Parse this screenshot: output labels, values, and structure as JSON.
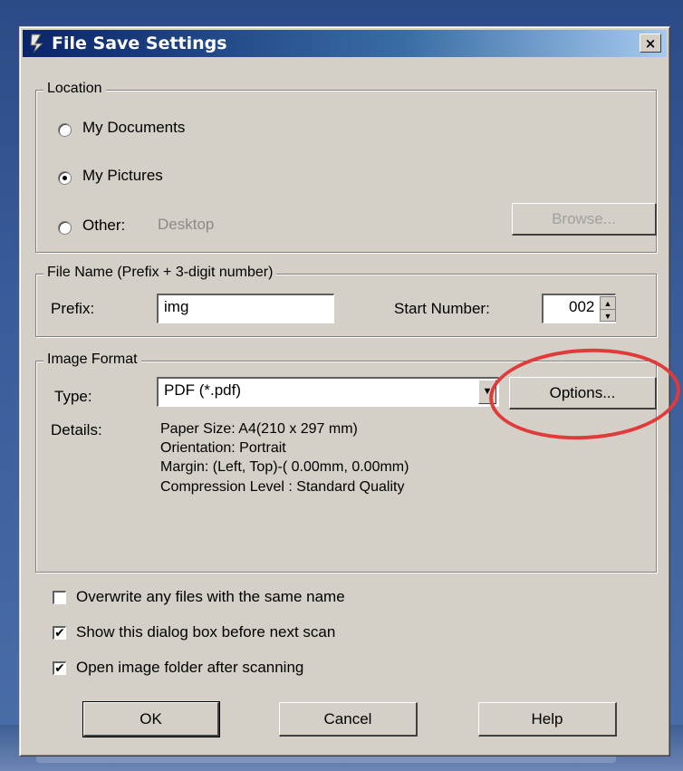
{
  "window": {
    "title": "File Save Settings",
    "close_glyph": "×",
    "app_icon": "scanner-app-icon"
  },
  "location": {
    "legend": "Location",
    "options": [
      {
        "label": "My Documents",
        "checked": false
      },
      {
        "label": "My Pictures",
        "checked": true
      },
      {
        "label": "Other:",
        "checked": false
      }
    ],
    "other_path": "Desktop",
    "browse_label": "Browse..."
  },
  "file_name": {
    "legend": "File Name (Prefix + 3-digit number)",
    "prefix_label": "Prefix:",
    "prefix_value": "img",
    "start_number_label": "Start Number:",
    "start_number_value": "002"
  },
  "image_format": {
    "legend": "Image Format",
    "type_label": "Type:",
    "type_value": "PDF (*.pdf)",
    "options_label": "Options...",
    "details_label": "Details:",
    "details": [
      "Paper Size: A4(210 x 297 mm)",
      "Orientation: Portrait",
      "Margin: (Left, Top)-( 0.00mm, 0.00mm)",
      "Compression Level : Standard Quality"
    ]
  },
  "checkboxes": [
    {
      "label": "Overwrite any files with the same name",
      "checked": false
    },
    {
      "label": "Show this dialog box before next scan",
      "checked": true
    },
    {
      "label": "Open image folder after scanning",
      "checked": true
    }
  ],
  "buttons": {
    "ok": "OK",
    "cancel": "Cancel",
    "help": "Help"
  },
  "annotation": {
    "highlight_color": "#e03a3a"
  }
}
